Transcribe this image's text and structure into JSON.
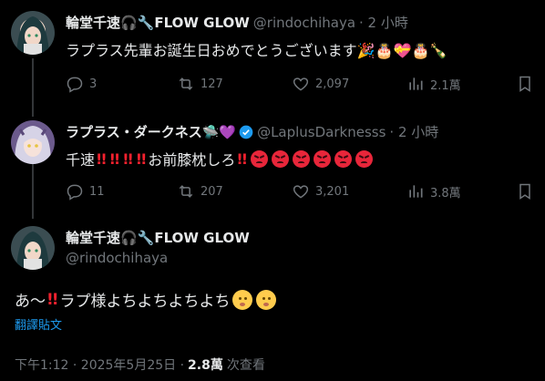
{
  "tweets": [
    {
      "name": "輪堂千速🎧🔧FLOW GLOW",
      "handle": "@rindochihaya",
      "time": "· 2 小時",
      "text": "ラプラス先輩お誕生日おめでとうございます🎉🎂💝🎂🍾",
      "replies": "3",
      "retweets": "127",
      "likes": "2,097",
      "views": "2.1萬"
    },
    {
      "name": "ラプラス・ダークネス🛸💜",
      "handle": "@LaplusDarknesss",
      "time": "· 2 小時",
      "text_prefix": "千速",
      "text_mid": "お前膝枕しろ",
      "replies": "11",
      "retweets": "207",
      "likes": "3,201",
      "views": "3.8萬"
    }
  ],
  "main": {
    "name": "輪堂千速🎧🔧FLOW GLOW",
    "handle": "@rindochihaya",
    "text_prefix": "あ～",
    "text_main": "ラプ様よちよちよちよち",
    "translate": "翻譯貼文",
    "timestamp": "下午1:12 · 2025年5月25日 ·",
    "views": "2.8萬",
    "views_label": "次查看"
  },
  "icons": {
    "reply": "reply-icon",
    "retweet": "retweet-icon",
    "like": "heart-icon",
    "views": "views-icon",
    "bookmark": "bookmark-icon"
  },
  "colors": {
    "accent": "#1d9bf0",
    "muted": "#71767b",
    "text": "#e7e9ea"
  }
}
